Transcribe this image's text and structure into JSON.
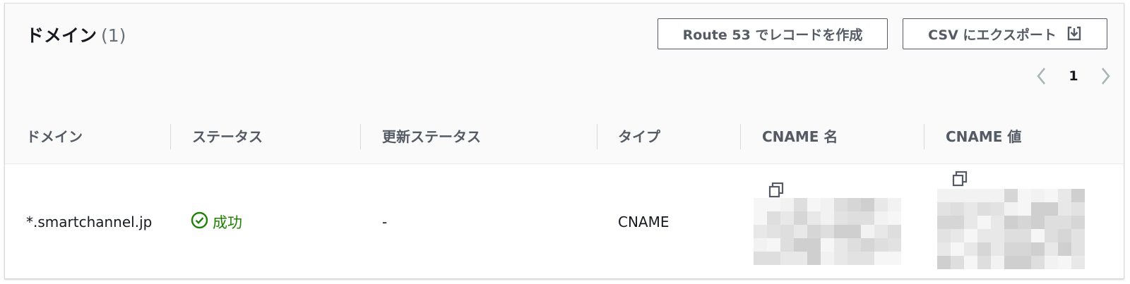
{
  "header": {
    "title": "ドメイン",
    "count": "(1)",
    "buttons": {
      "route53": "Route 53 でレコードを作成",
      "csv_export": "CSV にエクスポート"
    },
    "pagination": {
      "current_page": "1"
    }
  },
  "table": {
    "columns": [
      "ドメイン",
      "ステータス",
      "更新ステータス",
      "タイプ",
      "CNAME 名",
      "CNAME 値"
    ],
    "rows": [
      {
        "domain": "*.smartchannel.jp",
        "status": "成功",
        "renewal_status": "-",
        "type": "CNAME",
        "cname_name": "",
        "cname_value": ""
      }
    ]
  },
  "icons": {
    "status": "success-check-circle-icon",
    "copy": "copy-icon",
    "export": "download-icon",
    "prev": "chevron-left-icon",
    "next": "chevron-right-icon"
  },
  "colors": {
    "success": "#1d8102",
    "button_border": "#545b64",
    "header_bg": "#fafafa"
  }
}
